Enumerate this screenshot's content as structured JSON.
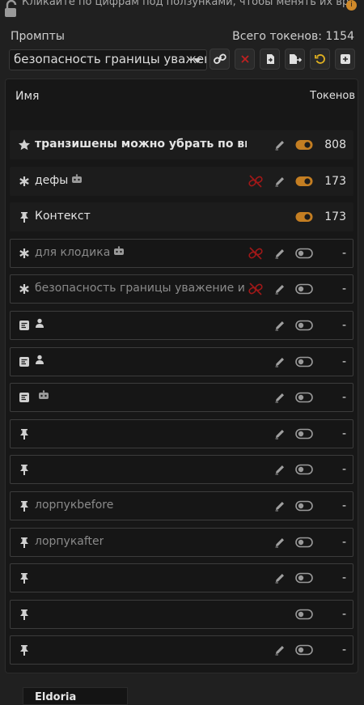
{
  "top": {
    "hint": "Кликайте по цифрам под ползунками, чтобы менять их вручную."
  },
  "header": {
    "title": "Промпты",
    "total_tokens": "Всего токенов: 1154"
  },
  "preset": {
    "selected": "безопасность границы уважение и"
  },
  "toolbar": {
    "buttons": [
      "link-icon",
      "delete-icon",
      "import-icon",
      "export-icon",
      "reset-icon",
      "add-icon"
    ]
  },
  "table": {
    "col_name": "Имя",
    "col_tokens": "Токенов",
    "rows": [
      {
        "icon": "star-icon",
        "label": "транзишены можно убрать по вку",
        "bold": true,
        "bot": false,
        "user": false,
        "unlink": false,
        "pencil": true,
        "enabled": true,
        "tokens": "808"
      },
      {
        "icon": "asterisk-icon",
        "label": "дефы",
        "bold": false,
        "bot": true,
        "user": false,
        "unlink": true,
        "pencil": true,
        "enabled": true,
        "tokens": "173"
      },
      {
        "icon": "pin-icon",
        "label": "Контекст",
        "bold": false,
        "bot": false,
        "user": false,
        "unlink": false,
        "pencil": false,
        "enabled": true,
        "tokens": "173"
      },
      {
        "icon": "asterisk-icon",
        "label": "для клодика",
        "bold": false,
        "bot": true,
        "user": false,
        "unlink": true,
        "pencil": true,
        "enabled": false,
        "tokens": "-"
      },
      {
        "icon": "asterisk-icon",
        "label": "безопасность границы уважение и",
        "bold": false,
        "bot": false,
        "user": false,
        "unlink": true,
        "pencil": true,
        "enabled": false,
        "tokens": "-"
      },
      {
        "icon": "doc-icon",
        "label": "",
        "bold": false,
        "bot": false,
        "user": true,
        "unlink": false,
        "pencil": true,
        "enabled": false,
        "tokens": "-"
      },
      {
        "icon": "doc-icon",
        "label": "",
        "bold": false,
        "bot": false,
        "user": true,
        "unlink": false,
        "pencil": true,
        "enabled": false,
        "tokens": "-"
      },
      {
        "icon": "doc-icon",
        "label": "",
        "bold": false,
        "bot": true,
        "user": false,
        "unlink": false,
        "pencil": true,
        "enabled": false,
        "tokens": "-"
      },
      {
        "icon": "pin-icon",
        "label": "",
        "bold": false,
        "bot": false,
        "user": false,
        "unlink": false,
        "pencil": true,
        "enabled": false,
        "tokens": "-"
      },
      {
        "icon": "pin-icon",
        "label": "",
        "bold": false,
        "bot": false,
        "user": false,
        "unlink": false,
        "pencil": true,
        "enabled": false,
        "tokens": "-"
      },
      {
        "icon": "pin-icon",
        "label": "лорпукbefore",
        "bold": false,
        "bot": false,
        "user": false,
        "unlink": false,
        "pencil": true,
        "enabled": false,
        "tokens": "-"
      },
      {
        "icon": "pin-icon",
        "label": "лорпукafter",
        "bold": false,
        "bot": false,
        "user": false,
        "unlink": false,
        "pencil": true,
        "enabled": false,
        "tokens": "-"
      },
      {
        "icon": "pin-icon",
        "label": "",
        "bold": false,
        "bot": false,
        "user": false,
        "unlink": false,
        "pencil": true,
        "enabled": false,
        "tokens": "-"
      },
      {
        "icon": "pin-icon",
        "label": "",
        "bold": false,
        "bot": false,
        "user": false,
        "unlink": false,
        "pencil": false,
        "enabled": false,
        "tokens": "-"
      },
      {
        "icon": "pin-icon",
        "label": "",
        "bold": false,
        "bot": false,
        "user": false,
        "unlink": false,
        "pencil": true,
        "enabled": false,
        "tokens": "-"
      }
    ]
  },
  "footer": {
    "tab_label": "Eldoria"
  },
  "colors": {
    "accent": "#d08a2a",
    "danger": "#b02020",
    "background": "#202020"
  }
}
